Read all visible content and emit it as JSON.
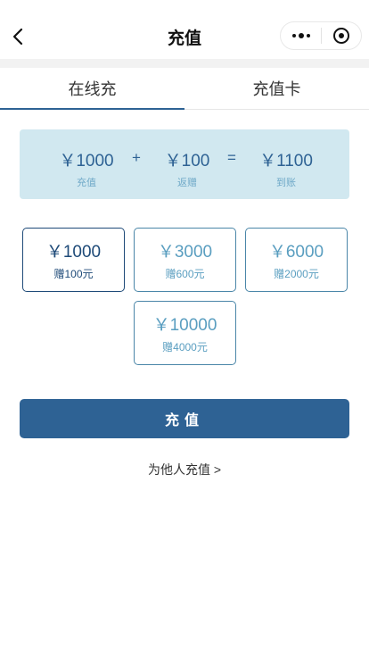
{
  "nav": {
    "title": "充值",
    "back_icon": "chevron-left-icon",
    "menu_icon": "more-dots-icon",
    "close_icon": "target-circle-icon"
  },
  "tabs": [
    {
      "label": "在线充",
      "active": true
    },
    {
      "label": "充值卡",
      "active": false
    }
  ],
  "summary": {
    "recharge_amount": "￥1000",
    "recharge_label": "充值",
    "plus": "+",
    "bonus_amount": "￥100",
    "bonus_label": "返赠",
    "equals": "=",
    "total_amount": "￥1100",
    "total_label": "到账"
  },
  "options": [
    {
      "amount": "￥1000",
      "bonus": "赠100元",
      "selected": true
    },
    {
      "amount": "￥3000",
      "bonus": "赠600元",
      "selected": false
    },
    {
      "amount": "￥6000",
      "bonus": "赠2000元",
      "selected": false
    },
    {
      "amount": "￥10000",
      "bonus": "赠4000元",
      "selected": false
    }
  ],
  "submit_label": "充值",
  "other_link": "为他人充值 >",
  "colors": {
    "primary": "#2e6294",
    "selected_border": "#1e4a78",
    "option_text": "#5a9ec0",
    "summary_bg": "#d1e8f0"
  }
}
